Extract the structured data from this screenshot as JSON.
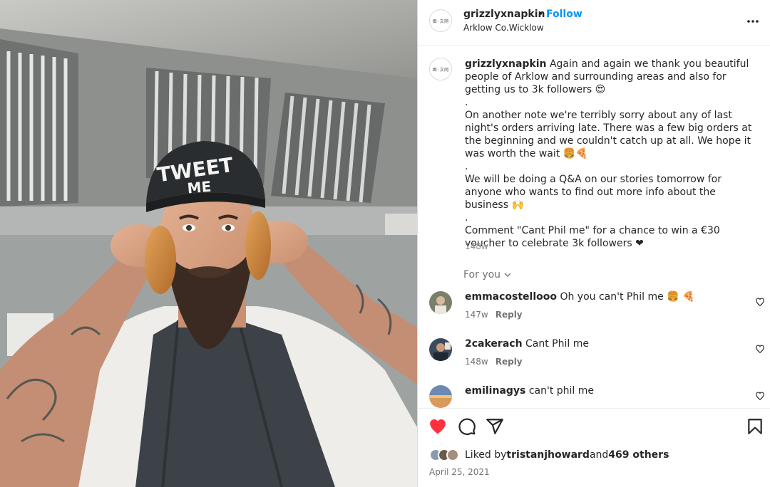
{
  "post": {
    "username": "grizzlyxnapkin",
    "follow_label": "Follow",
    "separator": "•",
    "location": "Arklow Co.Wicklow",
    "avatar_text": "图·文网"
  },
  "photo": {
    "cap_text_1": "TWEET",
    "cap_text_2": "ME"
  },
  "caption": {
    "username": "grizzlyxnapkin",
    "lines": [
      " Again and again we thank you beautiful people of Arklow and surrounding areas and also for getting us to 3k followers 😍",
      ".",
      "On another note we're terribly sorry about any of last night's orders arriving late. There was a few big orders at the beginning and we couldn't catch up at all. We hope it was worth the wait 🍔🍕",
      ".",
      "We will be doing a Q&A on our stories tomorrow for anyone who wants to find out more info about the business 🙌",
      ".",
      "Comment \"Cant Phil me\" for a chance to win a €30 voucher to celebrate 3k followers ❤"
    ],
    "time": "148w"
  },
  "filter": {
    "label": "For you"
  },
  "comments": [
    {
      "user": "emmacostellooo",
      "text": "Oh you can't Phil me 🍔 🍕",
      "time": "147w",
      "reply": "Reply",
      "avatar_color": "#7a7f6a"
    },
    {
      "user": "2cakerach",
      "text": "Cant Phil me",
      "time": "148w",
      "reply": "Reply",
      "avatar_color": "#3b4a5c"
    },
    {
      "user": "emilinagys",
      "text": "can't phil me",
      "time": "",
      "reply": "",
      "avatar_color": "#d99a5b"
    }
  ],
  "likes": {
    "prefix": "Liked by ",
    "user": "tristanjhoward",
    "middle": " and ",
    "count": "469 others"
  },
  "date": "April 25, 2021",
  "colors": {
    "like_red": "#ff3040",
    "follow_blue": "#0095f6",
    "muted": "#737373"
  }
}
